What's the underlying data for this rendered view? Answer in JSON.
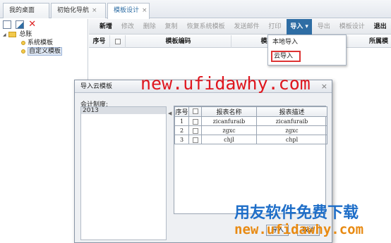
{
  "tabs": [
    {
      "label": "我的桌面"
    },
    {
      "label": "初始化导航",
      "close": "×"
    },
    {
      "label": "模板设计",
      "close": "×"
    }
  ],
  "left_toolbar": {
    "icons": [
      "new-file-icon",
      "edit-icon",
      "delete-icon"
    ],
    "delete_glyph": "✕"
  },
  "tree": {
    "root": {
      "toggle": "◢",
      "label": "总账"
    },
    "children": [
      {
        "label": "系统模板"
      },
      {
        "label": "自定义模板"
      }
    ]
  },
  "toolbar": {
    "new": "新增",
    "modify": "修改",
    "delete": "删除",
    "copy": "复制",
    "system_template": "恢复系统模板",
    "send_mail": "发送邮件",
    "print": "打印",
    "import": "导入",
    "import_caret": "▾",
    "export": "导出",
    "design": "模板设计",
    "exit": "退出"
  },
  "grid_headers": {
    "seq": "序号",
    "code": "模板编码",
    "name": "模板名称",
    "belong": "所属模"
  },
  "import_menu": {
    "local": "本地导入",
    "cloud": "云导入"
  },
  "dialog": {
    "title": "导入云模板",
    "close": "×",
    "acct_label": "会计制度:",
    "acct_items": [
      "2013"
    ],
    "splitter": "◀",
    "table": {
      "headers": {
        "seq": "序号",
        "name": "报表名称",
        "desc": "报表描述"
      },
      "rows": [
        {
          "seq": "1",
          "name": "zicanfuraib",
          "desc": "zicanfuraib"
        },
        {
          "seq": "2",
          "name": "zgxc",
          "desc": "zgxc"
        },
        {
          "seq": "3",
          "name": "chjl",
          "desc": "chpl"
        }
      ]
    },
    "import_btn": "导入",
    "cancel_btn": "取消"
  },
  "watermark": {
    "top": "new.ufidawhy.com",
    "bottom_cn": "用友软件免费下载",
    "bottom_url": "new.ufidawhy.com"
  },
  "colors": {
    "accent": "#2e6da4",
    "watermark_red": "#e0161e",
    "watermark_blue": "#1e6ec8",
    "watermark_orange": "#e88a12"
  }
}
